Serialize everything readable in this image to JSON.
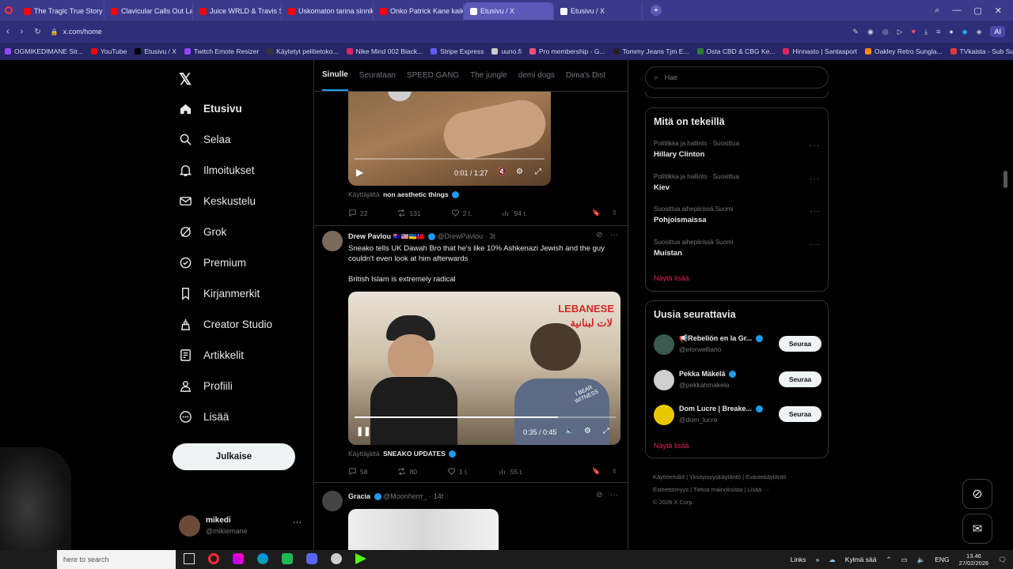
{
  "browser": {
    "tabs": [
      {
        "label": "The Tragic True Story of Ju",
        "color": "#ff0000"
      },
      {
        "label": "Clavicular Calls Out Larry",
        "color": "#ff0000"
      },
      {
        "label": "Juice WRLD & Travis Scott",
        "color": "#ff0000"
      },
      {
        "label": "Uskomaton tarina sinnikk",
        "color": "#ff0000"
      },
      {
        "label": "Onko Patrick Kane kaikkie",
        "color": "#ff0000"
      },
      {
        "label": "Etusivu / X",
        "color": "#ffffff"
      },
      {
        "label": "Etusivu / X",
        "color": "#ffffff"
      }
    ],
    "url": "x.com/home",
    "ai_label": "AI",
    "bookmarks": [
      {
        "label": "OGMIKEDIMANE Str...",
        "color": "#9147ff"
      },
      {
        "label": "YouTube",
        "color": "#ff0000"
      },
      {
        "label": "Etusivu / X",
        "color": "#000000"
      },
      {
        "label": "Twitch Emote Resizer",
        "color": "#9147ff"
      },
      {
        "label": "Käytetyt pelitietoko...",
        "color": "#333333"
      },
      {
        "label": "Nike Mind 002 Black...",
        "color": "#e0245e"
      },
      {
        "label": "Stripe Express",
        "color": "#635bff"
      },
      {
        "label": "uuno.fi",
        "color": "#cccccc"
      },
      {
        "label": "Pro membership - G...",
        "color": "#ff4d6d"
      },
      {
        "label": "Tommy Jeans Tjm E...",
        "color": "#222222"
      },
      {
        "label": "Osta CBD & CBG Ke...",
        "color": "#2e7d32"
      },
      {
        "label": "Hinnasto | Santasport",
        "color": "#e0245e"
      },
      {
        "label": "Oakley Retro Sungla...",
        "color": "#ff8a00"
      },
      {
        "label": "TVkaista - Sub Suora",
        "color": "#e53935"
      }
    ]
  },
  "sidebar": {
    "items": [
      {
        "label": "Etusivu",
        "icon": "home-icon"
      },
      {
        "label": "Selaa",
        "icon": "search-icon"
      },
      {
        "label": "Ilmoitukset",
        "icon": "bell-icon"
      },
      {
        "label": "Keskustelu",
        "icon": "mail-icon"
      },
      {
        "label": "Grok",
        "icon": "grok-icon"
      },
      {
        "label": "Premium",
        "icon": "premium-icon"
      },
      {
        "label": "Kirjanmerkit",
        "icon": "bookmark-icon"
      },
      {
        "label": "Creator Studio",
        "icon": "creator-icon"
      },
      {
        "label": "Artikkelit",
        "icon": "article-icon"
      },
      {
        "label": "Profiili",
        "icon": "profile-icon"
      },
      {
        "label": "Lisää",
        "icon": "more-icon"
      }
    ],
    "post_label": "Julkaise",
    "account": {
      "name": "mikedi",
      "handle": "@mikiemane"
    }
  },
  "feed": {
    "tabs": [
      "Sinulle",
      "Seurataan",
      "SPEED GANG",
      "The jungle",
      "demi dogs",
      "Dima's Dist"
    ],
    "post1": {
      "time": "0:01 / 1:27",
      "used_by_prefix": "Käyttäjältä",
      "used_by": "non aesthetic things",
      "replies": "22",
      "reposts": "131",
      "likes": "2 t.",
      "views": "94 t."
    },
    "post2": {
      "name": "Drew Pavlou",
      "flags": "🇦🇺🇺🇸🇺🇦🇹🇼",
      "handle": "@DrewPavlou",
      "age": "3t",
      "text1": "Sneako tells UK Dawah Bro that he's like 10% Ashkenazi Jewish and the guy couldn't even look at him afterwards",
      "text2": "British Islam is extremely radical",
      "video_text": "LEBANESE",
      "video_arabic": "لات لبنانية",
      "shirt_text": "I BEAR WITNESS",
      "time": "0:35 / 0:45",
      "progress": 0.78,
      "used_by_prefix": "Käyttäjältä",
      "used_by": "SNEAKO UPDATES",
      "replies": "58",
      "reposts": "80",
      "likes": "1 t.",
      "views": "55 t."
    },
    "post3": {
      "name": "Gracia",
      "handle": "@Moonherrr_",
      "age": "14t"
    }
  },
  "right": {
    "search_placeholder": "Hae",
    "trends_title": "Mitä on tekeillä",
    "trends": [
      {
        "context": "Politiikka ja hallinto · Suosittua",
        "title": "Hillary Clinton"
      },
      {
        "context": "Politiikka ja hallinto · Suosittua",
        "title": "Kiev"
      },
      {
        "context": "Suosittua aihepiirissä Suomi",
        "title": "Pohjoismaissa"
      },
      {
        "context": "Suosittua aihepiirissä Suomi",
        "title": "Muistan"
      }
    ],
    "show_more": "Näytä lisää",
    "who_title": "Uusia seurattavia",
    "who": [
      {
        "name": "📢Rebelión en la Gr...",
        "handle": "@elorwelliano",
        "color": "#3a5a50"
      },
      {
        "name": "Pekka Mäkelä",
        "handle": "@pekkahmakela",
        "color": "#cfcfcf"
      },
      {
        "name": "Dom Lucre | Breake...",
        "handle": "@dom_lucre",
        "color": "#e8c800"
      }
    ],
    "follow_label": "Seuraa",
    "footer_row1": [
      "Käyttöehdot",
      "Yksityisyyskäytäntö",
      "Evästekäytäntö"
    ],
    "footer_row2": [
      "Esteettömyys",
      "Tietoa mainoksista",
      "Lisää ···"
    ],
    "copyright": "© 2026 X Corp."
  },
  "taskbar": {
    "search_placeholder": "here to search",
    "links": "Links",
    "weather": "Kylmä sää",
    "lang": "ENG",
    "time": "13.46",
    "date": "27/02/2026"
  }
}
